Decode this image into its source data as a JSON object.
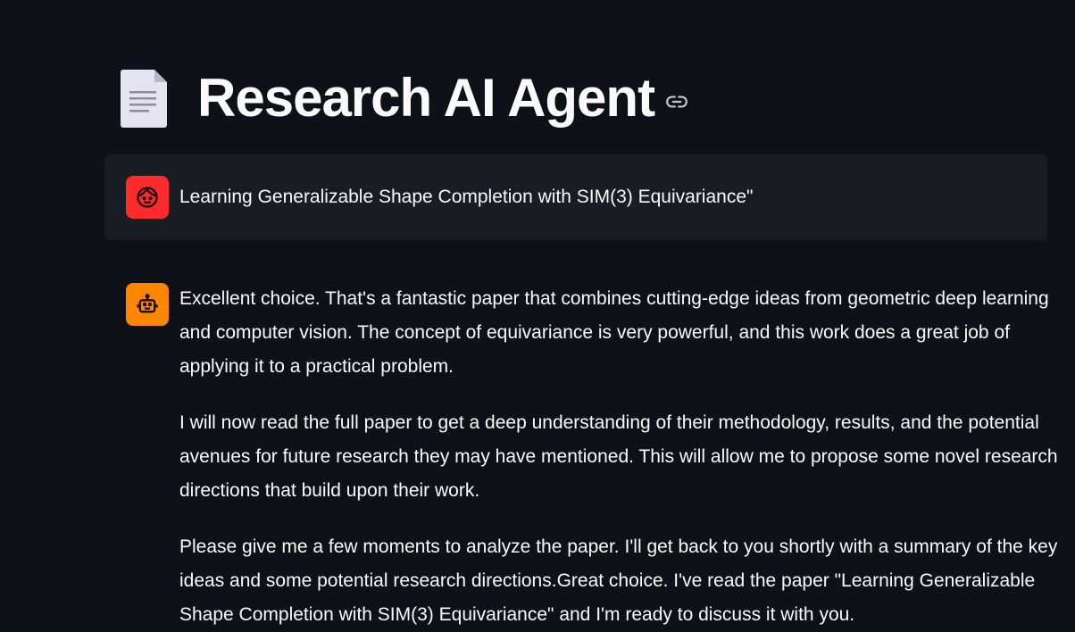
{
  "header": {
    "title": "Research AI Agent",
    "title_icon": "document-icon",
    "anchor_icon": "link-icon"
  },
  "messages": [
    {
      "role": "user",
      "avatar_icon": "user-face-icon",
      "avatar_color": "#ff2b2b",
      "text": "Learning Generalizable Shape Completion with SIM(3) Equivariance\""
    },
    {
      "role": "assistant",
      "avatar_icon": "robot-icon",
      "avatar_color": "#ff8700",
      "paragraphs": [
        "Excellent choice. That's a fantastic paper that combines cutting-edge ideas from geometric deep learning and computer vision. The concept of equivariance is very powerful, and this work does a great job of applying it to a practical problem.",
        "I will now read the full paper to get a deep understanding of their methodology, results, and the potential avenues for future research they may have mentioned. This will allow me to propose some novel research directions that build upon their work.",
        "Please give me a few moments to analyze the paper. I'll get back to you shortly with a summary of the key ideas and some potential research directions.Great choice. I've read the paper \"Learning Generalizable Shape Completion with SIM(3) Equivariance\" and I'm ready to discuss it with you."
      ]
    }
  ],
  "colors": {
    "background": "#0e1117",
    "user_bubble": "#1a1c24",
    "text": "#fafafa"
  }
}
